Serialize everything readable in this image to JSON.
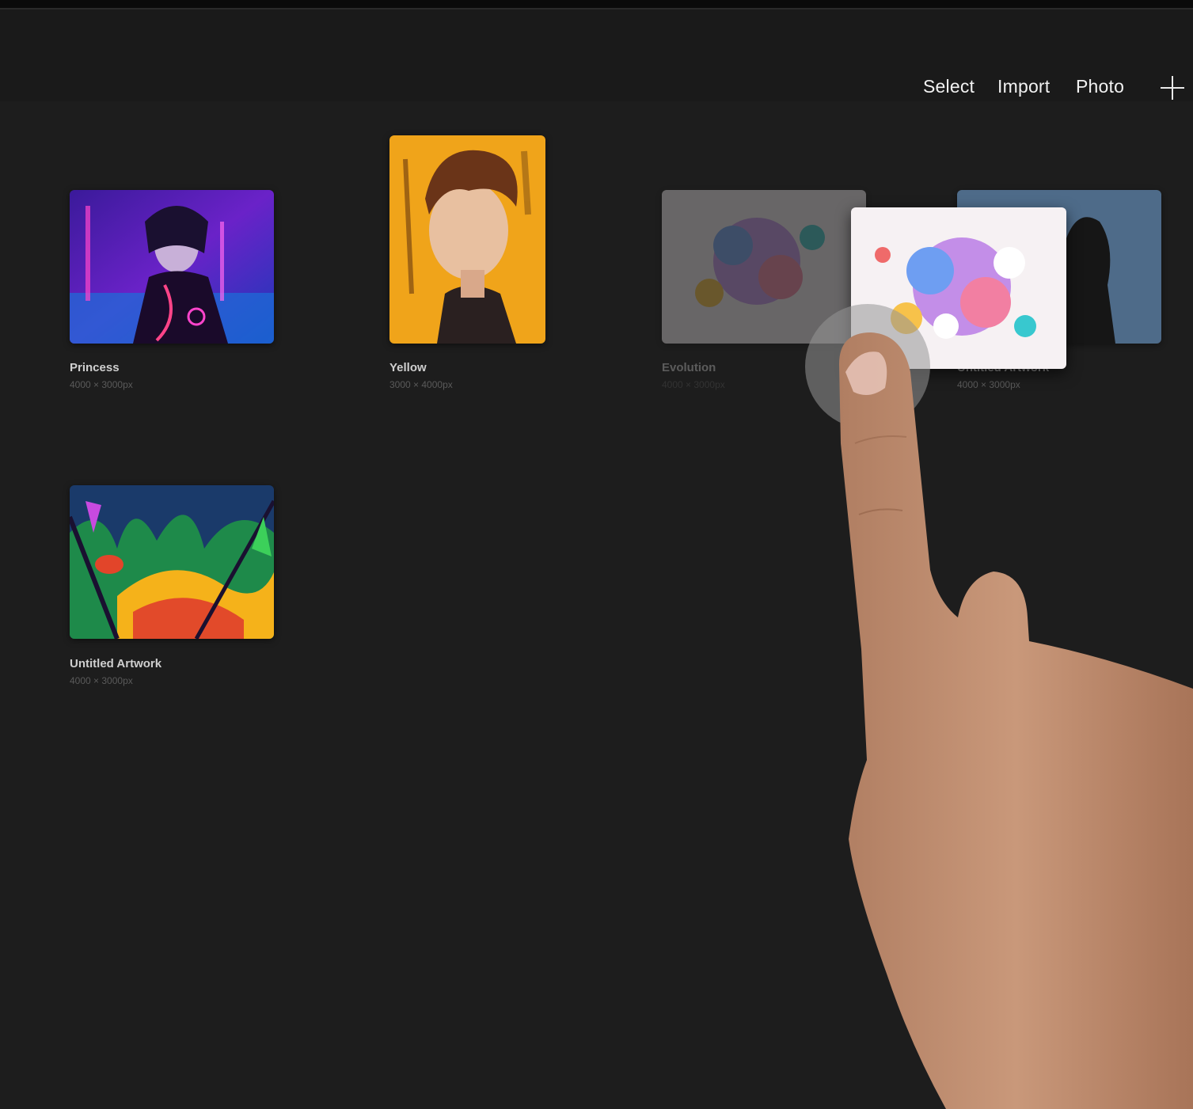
{
  "toolbar": {
    "select_label": "Select",
    "import_label": "Import",
    "photo_label": "Photo",
    "add_icon": "plus-icon"
  },
  "gallery": {
    "artworks": [
      {
        "title": "Princess",
        "dims": "4000 × 3000px"
      },
      {
        "title": "Yellow",
        "dims": "3000 × 4000px"
      },
      {
        "title": "Evolution",
        "dims": "4000 × 3000px"
      },
      {
        "title": "Untitled Artwork",
        "dims": "4000 × 3000px"
      },
      {
        "title": "Untitled Artwork",
        "dims": "4000 × 3000px"
      }
    ]
  },
  "colors": {
    "background": "#1d1d1d",
    "header": "#1a1a1a",
    "title_text": "#cfcfcf",
    "dims_text": "#5a5a5a"
  }
}
